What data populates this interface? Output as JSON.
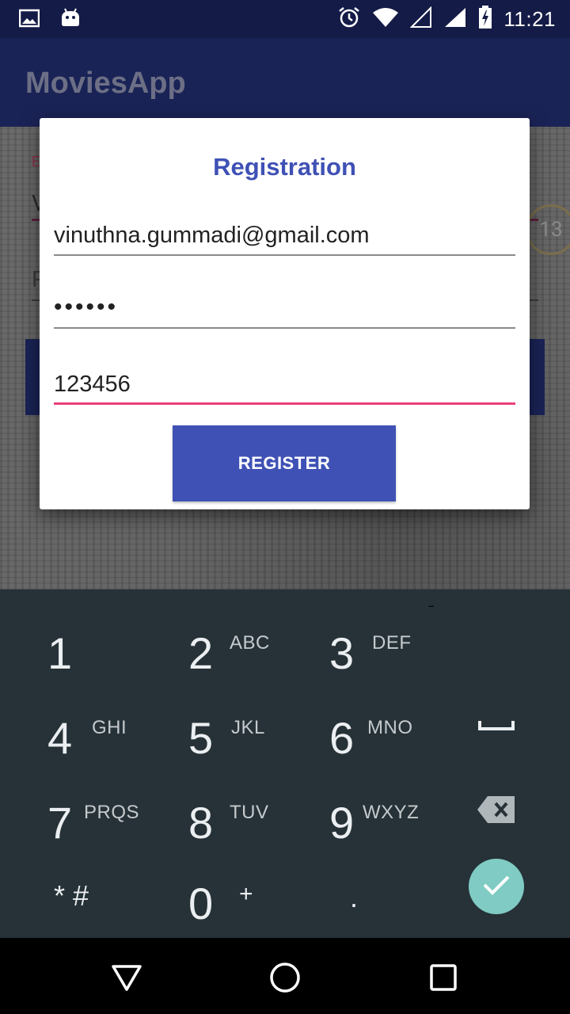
{
  "status_bar": {
    "time": "11:21",
    "left_icons": [
      "image-icon",
      "android-icon"
    ],
    "right_icons": [
      "alarm-icon",
      "wifi-icon",
      "no-sim-signal-icon",
      "signal-icon",
      "battery-charging-icon"
    ]
  },
  "app_bar": {
    "title": "MoviesApp"
  },
  "background": {
    "badge_text": "13",
    "partial_letters": [
      "E",
      "V",
      "P",
      "C",
      "C"
    ]
  },
  "dialog": {
    "title": "Registration",
    "email_value": "vinuthna.gummadi@gmail.com",
    "password_value": "••••••",
    "phone_value": "123456",
    "register_label": "REGISTER"
  },
  "keyboard": {
    "rows": [
      [
        {
          "digit": "1",
          "letters": ""
        },
        {
          "digit": "2",
          "letters": "ABC"
        },
        {
          "digit": "3",
          "letters": "DEF"
        },
        {
          "action": "−",
          "name": "minus-key"
        }
      ],
      [
        {
          "digit": "4",
          "letters": "GHI"
        },
        {
          "digit": "5",
          "letters": "JKL"
        },
        {
          "digit": "6",
          "letters": "MNO"
        },
        {
          "action": "space",
          "name": "space-key"
        }
      ],
      [
        {
          "digit": "7",
          "letters": "PRQS"
        },
        {
          "digit": "8",
          "letters": "TUV"
        },
        {
          "digit": "9",
          "letters": "WXYZ"
        },
        {
          "action": "backspace",
          "name": "backspace-key"
        }
      ],
      [
        {
          "digit": "* #",
          "letters": ""
        },
        {
          "digit": "0",
          "letters": "+"
        },
        {
          "digit": ".",
          "letters": ""
        },
        {
          "action": "done",
          "name": "done-key"
        }
      ]
    ],
    "colors": {
      "background": "#263238",
      "done": "#80cbc4"
    }
  },
  "nav_bar": {
    "buttons": [
      "back-icon",
      "home-icon",
      "recents-icon"
    ]
  },
  "colors": {
    "primary": "#3f51b5",
    "app_bar": "#1a2356",
    "accent": "#ec407a"
  }
}
